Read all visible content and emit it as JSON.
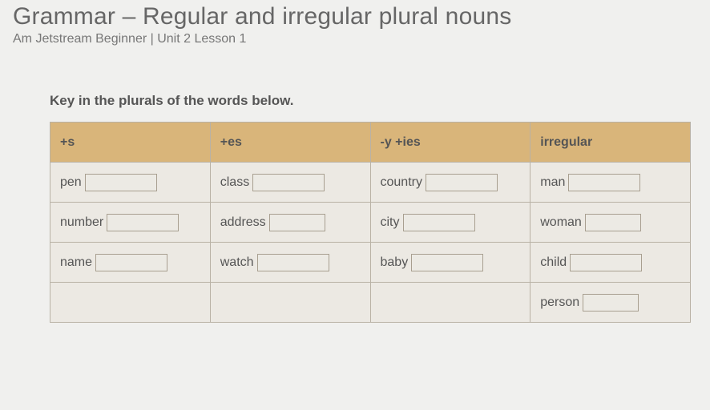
{
  "header": {
    "title": "Grammar – Regular and irregular plural nouns",
    "subtitle": "Am Jetstream Beginner | Unit 2 Lesson 1"
  },
  "instruction": "Key in the plurals of the words below.",
  "columns": [
    {
      "header": "+s",
      "words": [
        "pen",
        "number",
        "name",
        ""
      ]
    },
    {
      "header": "+es",
      "words": [
        "class",
        "address",
        "watch",
        ""
      ]
    },
    {
      "header": "-y +ies",
      "words": [
        "country",
        "city",
        "baby",
        ""
      ]
    },
    {
      "header": "irregular",
      "words": [
        "man",
        "woman",
        "child",
        "person"
      ]
    }
  ]
}
